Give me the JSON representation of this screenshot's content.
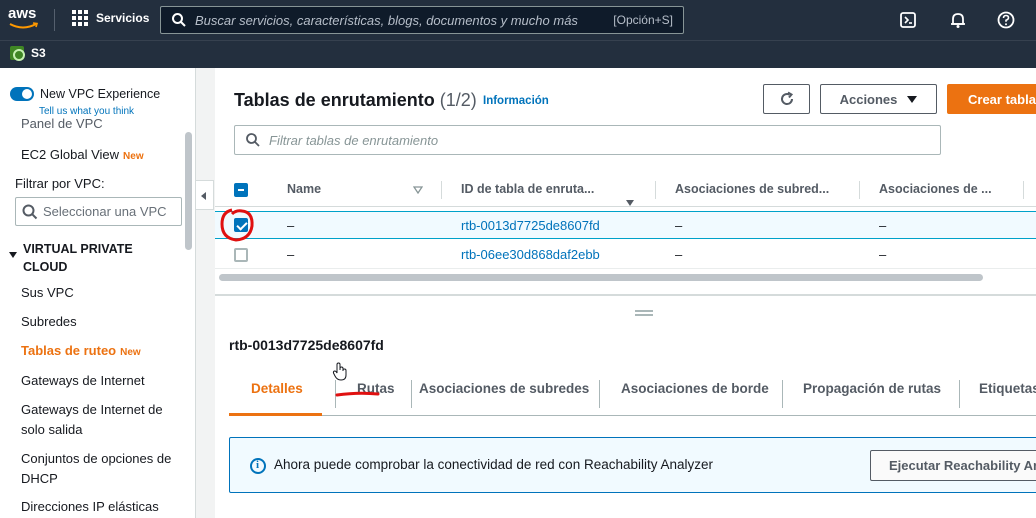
{
  "topnav": {
    "logo": "aws",
    "services_label": "Servicios",
    "search_placeholder": "Buscar servicios, características, blogs, documentos y mucho más",
    "search_shortcut": "[Opción+S]"
  },
  "service_bar": {
    "label": "S3"
  },
  "sidebar": {
    "experience_label": "New VPC Experience",
    "tell_us": "Tell us what you think",
    "panel_label": "Panel de VPC",
    "ec2_global_view": "EC2 Global View",
    "new_badge": "New",
    "filter_label": "Filtrar por VPC:",
    "filter_placeholder": "Seleccionar una VPC",
    "section": "VIRTUAL PRIVATE CLOUD",
    "items": [
      {
        "label": "Sus VPC",
        "active": false,
        "new": false
      },
      {
        "label": "Subredes",
        "active": false,
        "new": false
      },
      {
        "label": "Tablas de ruteo",
        "active": true,
        "new": true
      },
      {
        "label": "Gateways de Internet",
        "active": false,
        "new": false
      },
      {
        "label": "Gateways de Internet de solo salida",
        "active": false,
        "new": false
      },
      {
        "label": "Conjuntos de opciones de DHCP",
        "active": false,
        "new": false
      },
      {
        "label": "Direcciones IP elásticas",
        "active": false,
        "new": false
      }
    ]
  },
  "main": {
    "title": "Tablas de enrutamiento",
    "count": "(1/2)",
    "info_link": "Información",
    "actions_label": "Acciones",
    "create_label": "Crear tabla de enrutamiento",
    "filter_placeholder": "Filtrar tablas de enrutamiento",
    "columns": [
      "Name",
      "ID de tabla de enruta...",
      "Asociaciones de subred...",
      "Asociaciones de ..."
    ],
    "rows": [
      {
        "selected": true,
        "name": "–",
        "id": "rtb-0013d7725de8607fd",
        "subnet_assoc": "–",
        "edge_assoc": "–"
      },
      {
        "selected": false,
        "name": "–",
        "id": "rtb-06ee30d868daf2ebb",
        "subnet_assoc": "–",
        "edge_assoc": "–"
      }
    ]
  },
  "details": {
    "title": "rtb-0013d7725de8607fd",
    "tabs": [
      "Detalles",
      "Rutas",
      "Asociaciones de subredes",
      "Asociaciones de borde",
      "Propagación de rutas",
      "Etiquetas"
    ],
    "active_tab": "Detalles",
    "alert_message": "Ahora puede comprobar la conectividad de red con Reachability Analyzer",
    "alert_button": "Ejecutar Reachability Analyzer"
  },
  "colors": {
    "nav_bg": "#232f3e",
    "accent_orange": "#ec7211",
    "link_blue": "#0073bb",
    "annotation_red": "#e01010"
  }
}
